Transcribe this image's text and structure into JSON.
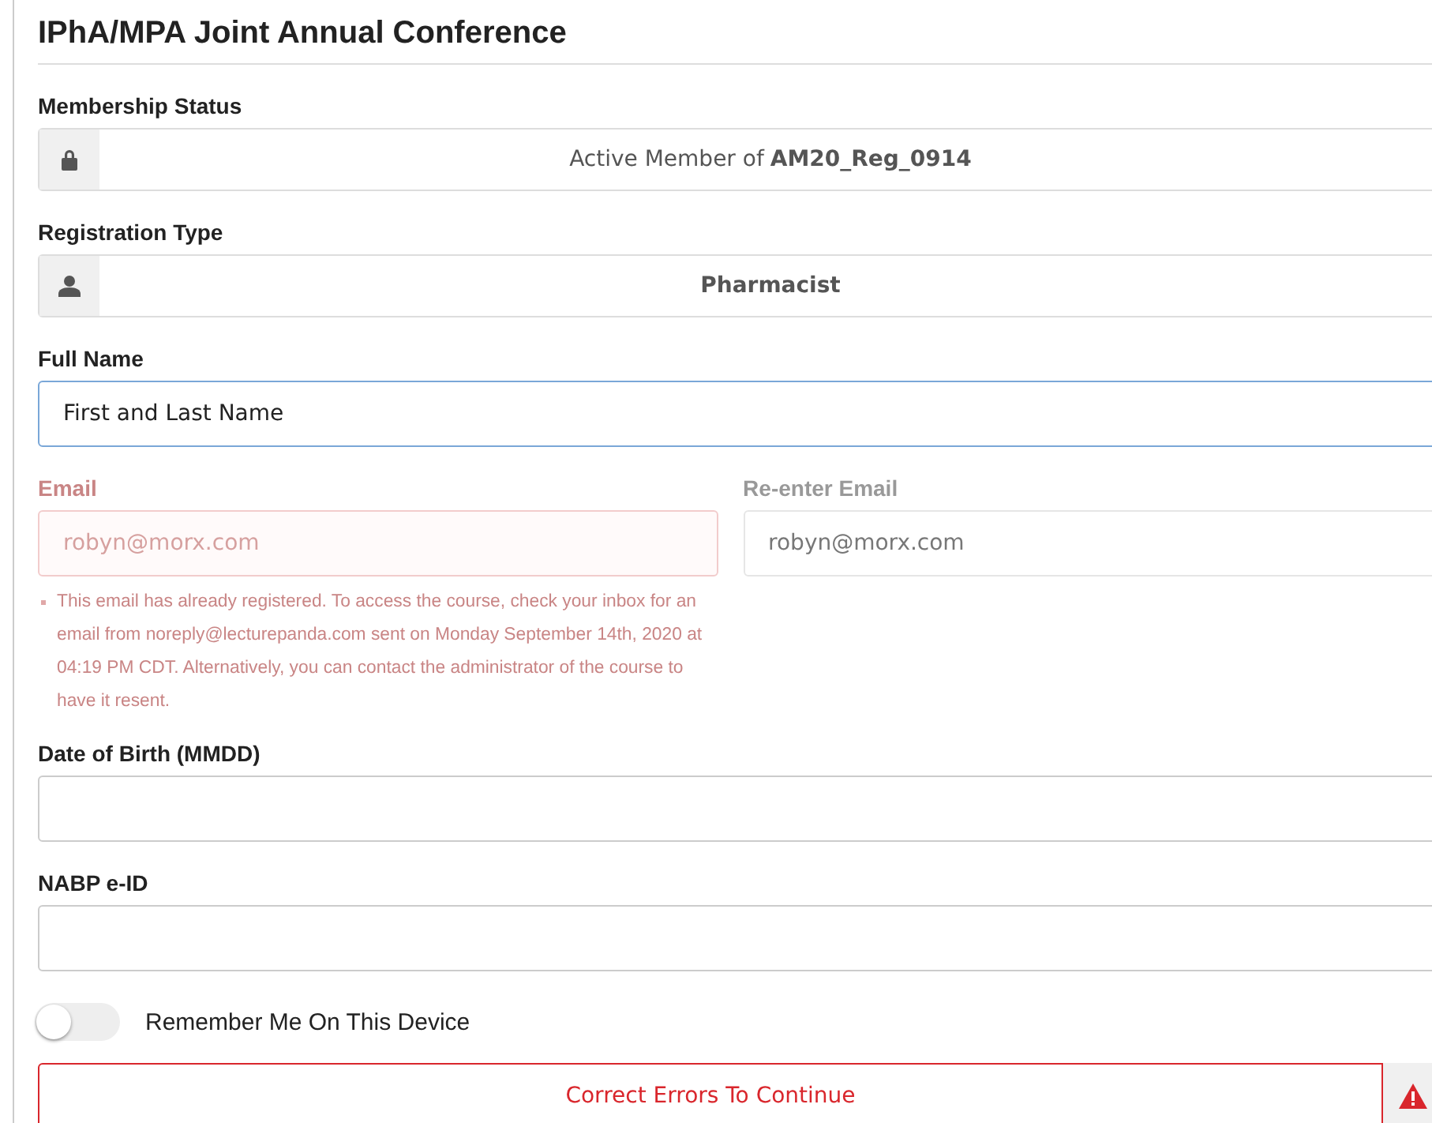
{
  "title": "IPhA/MPA Joint Annual Conference",
  "membership_status": {
    "label": "Membership Status",
    "value": "Active Member of **AM20_Reg_0914**"
  },
  "registration_type": {
    "label": "Registration Type",
    "value": "Pharmacist"
  },
  "full_name": {
    "label": "Full Name",
    "placeholder": "First and Last Name",
    "focused": true
  },
  "email": {
    "label": "Email",
    "value": "robyn@morx.com",
    "error": true
  },
  "reenter_email": {
    "label": "Re-enter Email",
    "value": "robyn@morx.com",
    "disabled": true
  },
  "email_error": "This email has already registered. To access the course, check your inbox for an email from noreply@lecturepanda.com sent on Monday September 14th, 2020 at 04:19 PM CDT. Alternatively, you can contact the administrator of the course to have it resent.",
  "date_of_birth": {
    "label": "Date of Birth (MMDD)"
  },
  "nabp_eid": {
    "label": "NABP e-ID"
  },
  "remember_device": {
    "label": "Remember Me On This Device",
    "on": false
  },
  "submit": {
    "label": "Correct Errors To Continue",
    "error": true
  }
}
